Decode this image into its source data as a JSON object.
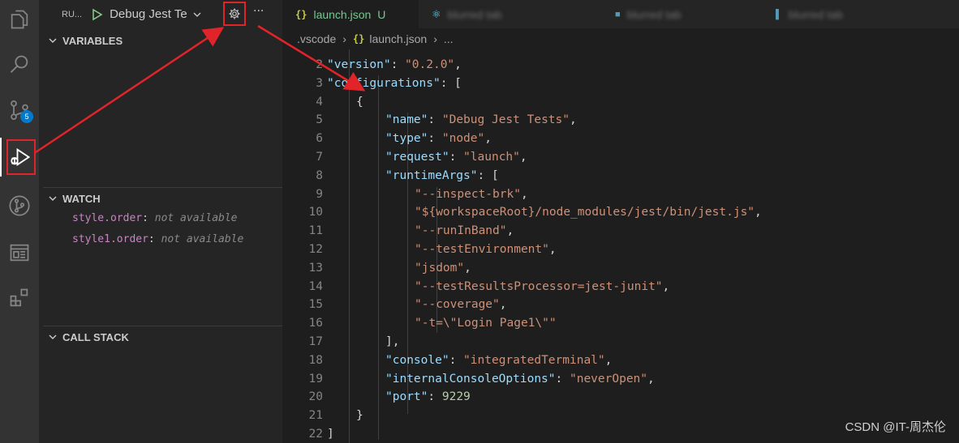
{
  "activity_bar": {
    "items": [
      {
        "name": "explorer-icon"
      },
      {
        "name": "search-icon"
      },
      {
        "name": "source-control-icon",
        "badge": "5"
      },
      {
        "name": "run-debug-icon"
      },
      {
        "name": "git-graph-icon"
      },
      {
        "name": "remote-explorer-icon"
      },
      {
        "name": "extensions-icon"
      }
    ]
  },
  "sidebar": {
    "title": "RU...",
    "config_name": "Debug Jest Te",
    "sections": {
      "variables": "VARIABLES",
      "watch": "WATCH",
      "call_stack": "CALL STACK"
    },
    "watch_items": [
      {
        "expr": "style.order",
        "value": "not available"
      },
      {
        "expr": "style1.order",
        "value": "not available"
      }
    ]
  },
  "tabs": [
    {
      "label": "launch.json",
      "status": "U",
      "active": true
    },
    {
      "label": "blurred tab",
      "active": false
    },
    {
      "label": "blurred tab",
      "active": false
    },
    {
      "label": "blurred tab",
      "active": false
    }
  ],
  "breadcrumb": {
    "folder": ".vscode",
    "file": "launch.json",
    "more": "..."
  },
  "code_lines": [
    {
      "n": "2",
      "indent": 1,
      "tokens": [
        [
          "k",
          "\"version\""
        ],
        [
          "p",
          ": "
        ],
        [
          "s",
          "\"0.2.0\""
        ],
        [
          "p",
          ","
        ]
      ]
    },
    {
      "n": "3",
      "indent": 1,
      "tokens": [
        [
          "k",
          "\"configurations\""
        ],
        [
          "p",
          ": ["
        ]
      ]
    },
    {
      "n": "4",
      "indent": 2,
      "tokens": [
        [
          "p",
          "{"
        ]
      ]
    },
    {
      "n": "5",
      "indent": 3,
      "tokens": [
        [
          "k",
          "\"name\""
        ],
        [
          "p",
          ": "
        ],
        [
          "s",
          "\"Debug Jest Tests\""
        ],
        [
          "p",
          ","
        ]
      ]
    },
    {
      "n": "6",
      "indent": 3,
      "tokens": [
        [
          "k",
          "\"type\""
        ],
        [
          "p",
          ": "
        ],
        [
          "s",
          "\"node\""
        ],
        [
          "p",
          ","
        ]
      ]
    },
    {
      "n": "7",
      "indent": 3,
      "tokens": [
        [
          "k",
          "\"request\""
        ],
        [
          "p",
          ": "
        ],
        [
          "s",
          "\"launch\""
        ],
        [
          "p",
          ","
        ]
      ]
    },
    {
      "n": "8",
      "indent": 3,
      "tokens": [
        [
          "k",
          "\"runtimeArgs\""
        ],
        [
          "p",
          ": ["
        ]
      ]
    },
    {
      "n": "9",
      "indent": 4,
      "tokens": [
        [
          "s",
          "\"--inspect-brk\""
        ],
        [
          "p",
          ","
        ]
      ]
    },
    {
      "n": "10",
      "indent": 4,
      "tokens": [
        [
          "s",
          "\"${workspaceRoot}/node_modules/jest/bin/jest.js\""
        ],
        [
          "p",
          ","
        ]
      ]
    },
    {
      "n": "11",
      "indent": 4,
      "tokens": [
        [
          "s",
          "\"--runInBand\""
        ],
        [
          "p",
          ","
        ]
      ]
    },
    {
      "n": "12",
      "indent": 4,
      "tokens": [
        [
          "s",
          "\"--testEnvironment\""
        ],
        [
          "p",
          ","
        ]
      ]
    },
    {
      "n": "13",
      "indent": 4,
      "tokens": [
        [
          "s",
          "\"jsdom\""
        ],
        [
          "p",
          ","
        ]
      ]
    },
    {
      "n": "14",
      "indent": 4,
      "tokens": [
        [
          "s",
          "\"--testResultsProcessor=jest-junit\""
        ],
        [
          "p",
          ","
        ]
      ]
    },
    {
      "n": "15",
      "indent": 4,
      "tokens": [
        [
          "s",
          "\"--coverage\""
        ],
        [
          "p",
          ","
        ]
      ]
    },
    {
      "n": "16",
      "indent": 4,
      "tokens": [
        [
          "s",
          "\"-t=\\\"Login Page1\\\"\""
        ]
      ]
    },
    {
      "n": "17",
      "indent": 3,
      "tokens": [
        [
          "p",
          "],"
        ]
      ]
    },
    {
      "n": "18",
      "indent": 3,
      "tokens": [
        [
          "k",
          "\"console\""
        ],
        [
          "p",
          ": "
        ],
        [
          "s",
          "\"integratedTerminal\""
        ],
        [
          "p",
          ","
        ]
      ]
    },
    {
      "n": "19",
      "indent": 3,
      "tokens": [
        [
          "k",
          "\"internalConsoleOptions\""
        ],
        [
          "p",
          ": "
        ],
        [
          "s",
          "\"neverOpen\""
        ],
        [
          "p",
          ","
        ]
      ]
    },
    {
      "n": "20",
      "indent": 3,
      "tokens": [
        [
          "k",
          "\"port\""
        ],
        [
          "p",
          ": "
        ],
        [
          "n",
          "9229"
        ]
      ]
    },
    {
      "n": "21",
      "indent": 2,
      "tokens": [
        [
          "p",
          "}"
        ]
      ]
    },
    {
      "n": "22",
      "indent": 1,
      "tokens": [
        [
          "p",
          "]"
        ]
      ]
    }
  ],
  "watermark": "CSDN @IT-周杰伦",
  "colors": {
    "annotation_red": "#e0242a",
    "accent_blue": "#007acc",
    "json_key": "#9cdcfe",
    "json_string": "#ce9178",
    "json_number": "#b5cea8",
    "untracked_green": "#73c991"
  }
}
